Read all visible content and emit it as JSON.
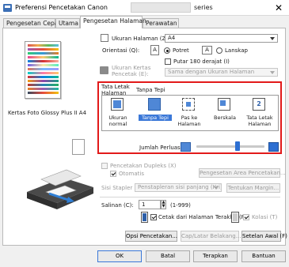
{
  "window": {
    "title": "Preferensi Pencetakan Canon",
    "title_suffix": "series",
    "close_glyph": "✕"
  },
  "tabs": [
    {
      "label": "Pengesetan Cepat"
    },
    {
      "label": "Utama"
    },
    {
      "label": "Pengesetan Halaman"
    },
    {
      "label": "Perawatan"
    }
  ],
  "left": {
    "paper_name": "Kertas Foto Glossy Plus II A4"
  },
  "page": {
    "page_size_label": "Ukuran Halaman (Z):",
    "page_size_value": "A4",
    "orientation_label": "Orientasi (Q):",
    "portrait_label": "Potret",
    "landscape_label": "Lanskap",
    "rotate_label": "Putar 180 derajat (I)",
    "printer_paper_label": "Ukuran Kertas Pencetak (E):",
    "printer_paper_value": "Sama dengan Ukuran Halaman"
  },
  "layout": {
    "title": "Tata Letak Halaman (Y):",
    "subtitle": "Tanpa Tepi",
    "items": [
      {
        "label": "Ukuran normal"
      },
      {
        "label": "Tanpa Tepi"
      },
      {
        "label": "Pas ke Halaman"
      },
      {
        "label": "Berskala"
      },
      {
        "label": "Tata Letak Halaman"
      }
    ],
    "extension_label": "Jumlah Perluasan:",
    "extension_level": 0.6
  },
  "duplex": {
    "label": "Pencetakan Dupleks (X)",
    "auto_label": "Otomatis",
    "area_button": "Pengesetan Area Pencetakan...",
    "staple_label": "Sisi Stapler (N):",
    "staple_value": "Penstapleran sisi panjang (Kri)",
    "margin_button": "Tentukan Margin..."
  },
  "copies": {
    "label": "Salinan (C):",
    "value": "1",
    "range": "(1-999)",
    "last_page_label": "Cetak dari Halaman Terakhir (R)",
    "collate_label": "Kolasi (T)"
  },
  "actions": {
    "print_options": "Opsi Pencetakan...",
    "stamp": "Cap/Latar Belakang...",
    "defaults": "Setelan Awal (F)"
  },
  "footer": {
    "ok": "OK",
    "cancel": "Batal",
    "apply": "Terapkan",
    "help": "Bantuan"
  },
  "colors": {
    "accent": "#3b78d8",
    "highlight_box": "#e21a1a"
  }
}
